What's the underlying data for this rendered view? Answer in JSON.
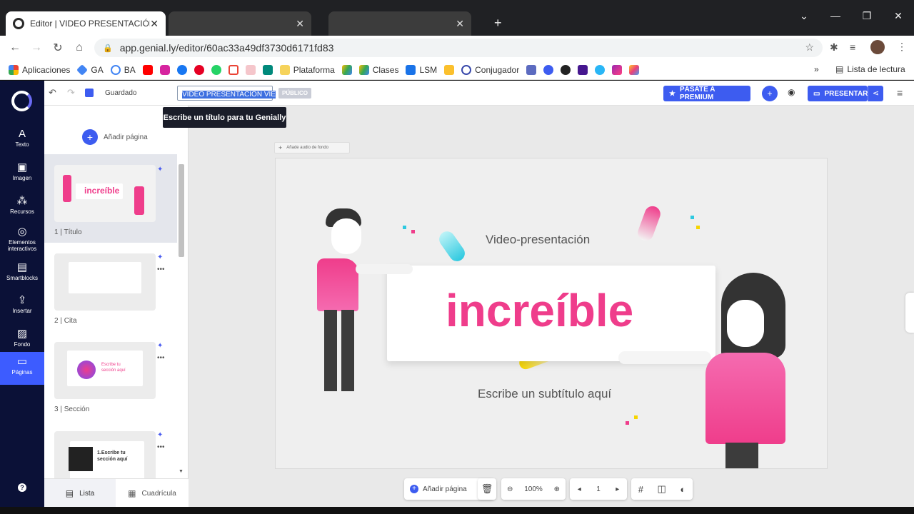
{
  "browser": {
    "active_tab_title": "Editor | VIDEO PRESENTACIÓN V",
    "new_tab": "+",
    "url": "app.genial.ly/editor/60ac33a49df3730d6171fd83",
    "bookmarks": [
      "Aplicaciones",
      "GA",
      "BA",
      "Plataforma",
      "Clases",
      "LSM",
      "Conjugador"
    ],
    "reading_list": "Lista de lectura",
    "close_glyph": "✕"
  },
  "toolbar": {
    "saved": "Guardado",
    "title_value": "VIDEO PRESENTACIÓN VIE",
    "public_badge": "PÚBLICO",
    "tooltip": "Escribe un título para tu Genially",
    "premium": "PÁSATE A PREMIUM",
    "present": "PRESENTAR"
  },
  "leftnav": {
    "items": [
      {
        "label": "Texto",
        "icon": "text-icon",
        "glyph": "A"
      },
      {
        "label": "Imagen",
        "icon": "image-icon",
        "glyph": "▣"
      },
      {
        "label": "Recursos",
        "icon": "resources-icon",
        "glyph": "⁂"
      },
      {
        "label": "Elementos interactivos",
        "icon": "interactive-icon",
        "glyph": "◎"
      },
      {
        "label": "Smartblocks",
        "icon": "smartblocks-icon",
        "glyph": "▤"
      },
      {
        "label": "Insertar",
        "icon": "insert-icon",
        "glyph": "⇪"
      },
      {
        "label": "Fondo",
        "icon": "background-icon",
        "glyph": "▨"
      },
      {
        "label": "Páginas",
        "icon": "pages-icon",
        "glyph": "▭"
      }
    ],
    "help": "?"
  },
  "pages": {
    "add_page": "Añadir página",
    "list": [
      {
        "label": "1 |  Título",
        "text": "increíble"
      },
      {
        "label": "2 |  Cita",
        "text": ""
      },
      {
        "label": "3 |  Sección",
        "text": "Escribe tu sección aquí"
      },
      {
        "label": "",
        "text": "1.Escribe tu sección aquí"
      }
    ],
    "view_list": "Lista",
    "view_grid": "Cuadrícula"
  },
  "canvas": {
    "add_audio": "Añade audio de fondo",
    "slide_top": "Video-presentación",
    "slide_main": "increíble",
    "slide_sub": "Escribe un subtítulo aquí"
  },
  "bottom": {
    "add_page": "Añadir página",
    "zoom": "100%",
    "page_num": "1"
  },
  "colors": {
    "accent": "#3d5cf0",
    "brand_pink": "#ef3d8b",
    "nav_bg": "#0b1137"
  }
}
